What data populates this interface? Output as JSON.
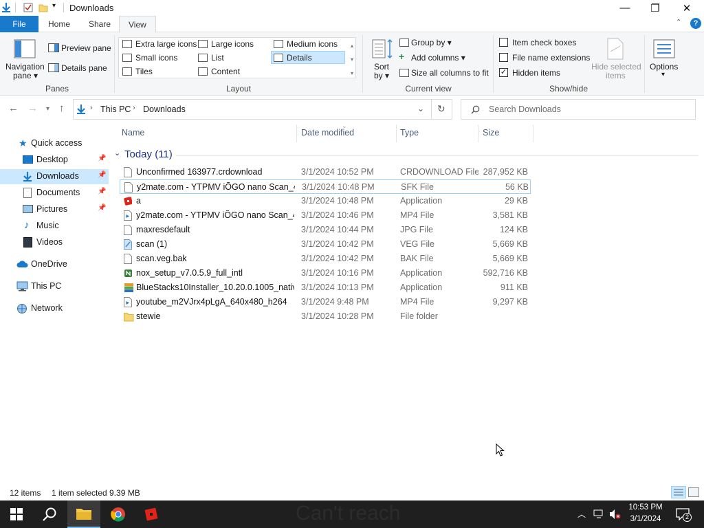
{
  "window": {
    "title": "Downloads"
  },
  "tabs": [
    {
      "label": "File"
    },
    {
      "label": "Home"
    },
    {
      "label": "Share"
    },
    {
      "label": "View"
    }
  ],
  "ribbon": {
    "panes": {
      "navigation_pane_line1": "Navigation",
      "navigation_pane_line2": "pane",
      "preview_pane": "Preview pane",
      "details_pane": "Details pane",
      "label": "Panes"
    },
    "layout": {
      "items": [
        "Extra large icons",
        "Large icons",
        "Medium icons",
        "Small icons",
        "List",
        "Details",
        "Tiles",
        "Content"
      ],
      "selected": "Details",
      "label": "Layout"
    },
    "current_view": {
      "sort_by_line1": "Sort",
      "sort_by_line2": "by",
      "group_by": "Group by",
      "add_columns": "Add columns",
      "size_all_columns": "Size all columns to fit",
      "label": "Current view"
    },
    "show_hide": {
      "item_check_boxes": "Item check boxes",
      "file_name_extensions": "File name extensions",
      "hidden_items": "Hidden items",
      "hidden_items_checked": true,
      "hide_selected_line1": "Hide selected",
      "hide_selected_line2": "items",
      "label": "Show/hide"
    },
    "options": {
      "label": "Options"
    }
  },
  "address": {
    "crumbs": [
      "This PC",
      "Downloads"
    ],
    "search_placeholder": "Search Downloads"
  },
  "nav": {
    "quick_access": "Quick access",
    "items": [
      {
        "label": "Desktop",
        "pinned": true
      },
      {
        "label": "Downloads",
        "pinned": true,
        "selected": true
      },
      {
        "label": "Documents",
        "pinned": true
      },
      {
        "label": "Pictures",
        "pinned": true
      },
      {
        "label": "Music"
      },
      {
        "label": "Videos"
      }
    ],
    "onedrive": "OneDrive",
    "this_pc": "This PC",
    "network": "Network"
  },
  "files": {
    "columns": [
      "Name",
      "Date modified",
      "Type",
      "Size"
    ],
    "group_header": "Today (11)",
    "rows": [
      {
        "name": "Unconfirmed 163977.crdownload",
        "date": "3/1/2024 10:52 PM",
        "type": "CRDOWNLOAD File",
        "size": "287,952 KB",
        "icon": "blank-file-icon"
      },
      {
        "name": "y2mate.com - YTPMV iÕGO nano Scan_4...",
        "date": "3/1/2024 10:48 PM",
        "type": "SFK File",
        "size": "56 KB",
        "icon": "blank-file-icon",
        "selected": true
      },
      {
        "name": "a",
        "date": "3/1/2024 10:48 PM",
        "type": "Application",
        "size": "29 KB",
        "icon": "roblox-app-icon"
      },
      {
        "name": "y2mate.com - YTPMV iÕGO nano Scan_4...",
        "date": "3/1/2024 10:46 PM",
        "type": "MP4 File",
        "size": "3,581 KB",
        "icon": "media-file-icon"
      },
      {
        "name": "maxresdefault",
        "date": "3/1/2024 10:44 PM",
        "type": "JPG File",
        "size": "124 KB",
        "icon": "blank-file-icon"
      },
      {
        "name": "scan (1)",
        "date": "3/1/2024 10:42 PM",
        "type": "VEG File",
        "size": "5,669 KB",
        "icon": "veg-file-icon"
      },
      {
        "name": "scan.veg.bak",
        "date": "3/1/2024 10:42 PM",
        "type": "BAK File",
        "size": "5,669 KB",
        "icon": "blank-file-icon"
      },
      {
        "name": "nox_setup_v7.0.5.9_full_intl",
        "date": "3/1/2024 10:16 PM",
        "type": "Application",
        "size": "592,716 KB",
        "icon": "nox-app-icon"
      },
      {
        "name": "BlueStacks10Installer_10.20.0.1005_native...",
        "date": "3/1/2024 10:13 PM",
        "type": "Application",
        "size": "911 KB",
        "icon": "bluestacks-app-icon"
      },
      {
        "name": "youtube_m2VJrx4pLgA_640x480_h264",
        "date": "3/1/2024 9:48 PM",
        "type": "MP4 File",
        "size": "9,297 KB",
        "icon": "media-file-icon"
      },
      {
        "name": "stewie",
        "date": "3/1/2024 10:28 PM",
        "type": "File folder",
        "size": "",
        "icon": "folder-icon"
      }
    ]
  },
  "status": {
    "item_count": "12 items",
    "selection": "1 item selected  9.39 MB"
  },
  "taskbar": {
    "watermark": "Can't reach",
    "time": "10:53 PM",
    "date": "3/1/2024",
    "notifications": "2"
  },
  "colors": {
    "accent": "#1979ca",
    "selection": "#cce8ff",
    "selection_border": "#99d1ff",
    "taskbar": "#1f1f1f"
  }
}
